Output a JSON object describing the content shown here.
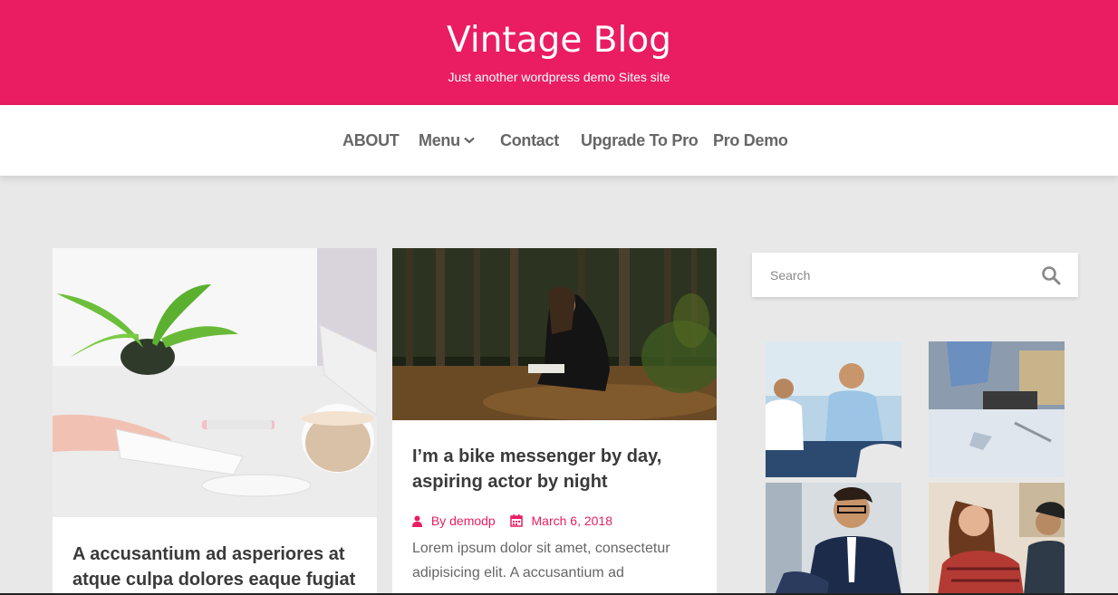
{
  "header": {
    "title": "Vintage Blog",
    "tagline": "Just another wordpress demo Sites site",
    "bg_color": "#ea1d63"
  },
  "nav": {
    "items": [
      {
        "label": "ABOUT"
      },
      {
        "label": "Menu",
        "has_dropdown": true
      },
      {
        "label": "Contact"
      },
      {
        "label": "Upgrade To Pro"
      },
      {
        "label": "Pro Demo"
      }
    ]
  },
  "posts": [
    {
      "title": "A accusantium ad asperiores at atque culpa dolores eaque fugiat",
      "image": "desk-keyboard-plant-coffee"
    },
    {
      "title": "I’m a bike messenger by day, aspiring actor by night",
      "image": "woman-sitting-in-forest",
      "author": "By demodp",
      "date": "March 6, 2018",
      "excerpt": "Lorem ipsum dolor sit amet, consectetur adipisicing elit. A accusantium ad"
    }
  ],
  "sidebar": {
    "search": {
      "placeholder": "Search"
    },
    "gallery": [
      "business-meeting",
      "laptop-desk-documents",
      "man-glasses-suit",
      "smiling-woman-laptop"
    ]
  },
  "colors": {
    "accent": "#ea1d63",
    "page_bg": "#e8e8e8"
  }
}
